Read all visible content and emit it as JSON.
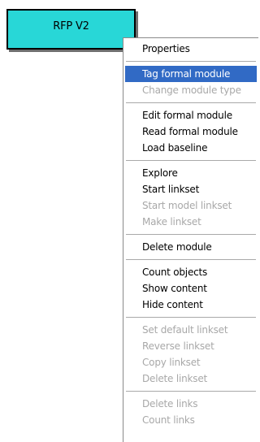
{
  "module_box": {
    "label": "RFP V2"
  },
  "context_menu": {
    "groups": [
      {
        "items": [
          {
            "label": "Properties",
            "enabled": true,
            "highlighted": false
          }
        ]
      },
      {
        "items": [
          {
            "label": "Tag formal module",
            "enabled": true,
            "highlighted": true
          },
          {
            "label": "Change module type",
            "enabled": false,
            "highlighted": false
          }
        ]
      },
      {
        "items": [
          {
            "label": "Edit formal module",
            "enabled": true,
            "highlighted": false
          },
          {
            "label": "Read formal module",
            "enabled": true,
            "highlighted": false
          },
          {
            "label": "Load baseline",
            "enabled": true,
            "highlighted": false
          }
        ]
      },
      {
        "items": [
          {
            "label": "Explore",
            "enabled": true,
            "highlighted": false
          },
          {
            "label": "Start linkset",
            "enabled": true,
            "highlighted": false
          },
          {
            "label": "Start model linkset",
            "enabled": false,
            "highlighted": false
          },
          {
            "label": "Make linkset",
            "enabled": false,
            "highlighted": false
          }
        ]
      },
      {
        "items": [
          {
            "label": "Delete module",
            "enabled": true,
            "highlighted": false
          }
        ]
      },
      {
        "items": [
          {
            "label": "Count objects",
            "enabled": true,
            "highlighted": false
          },
          {
            "label": "Show content",
            "enabled": true,
            "highlighted": false
          },
          {
            "label": "Hide content",
            "enabled": true,
            "highlighted": false
          }
        ]
      },
      {
        "items": [
          {
            "label": "Set default linkset",
            "enabled": false,
            "highlighted": false
          },
          {
            "label": "Reverse linkset",
            "enabled": false,
            "highlighted": false
          },
          {
            "label": "Copy linkset",
            "enabled": false,
            "highlighted": false
          },
          {
            "label": "Delete linkset",
            "enabled": false,
            "highlighted": false
          }
        ]
      },
      {
        "items": [
          {
            "label": "Delete links",
            "enabled": false,
            "highlighted": false
          },
          {
            "label": "Count links",
            "enabled": false,
            "highlighted": false
          }
        ]
      }
    ]
  }
}
